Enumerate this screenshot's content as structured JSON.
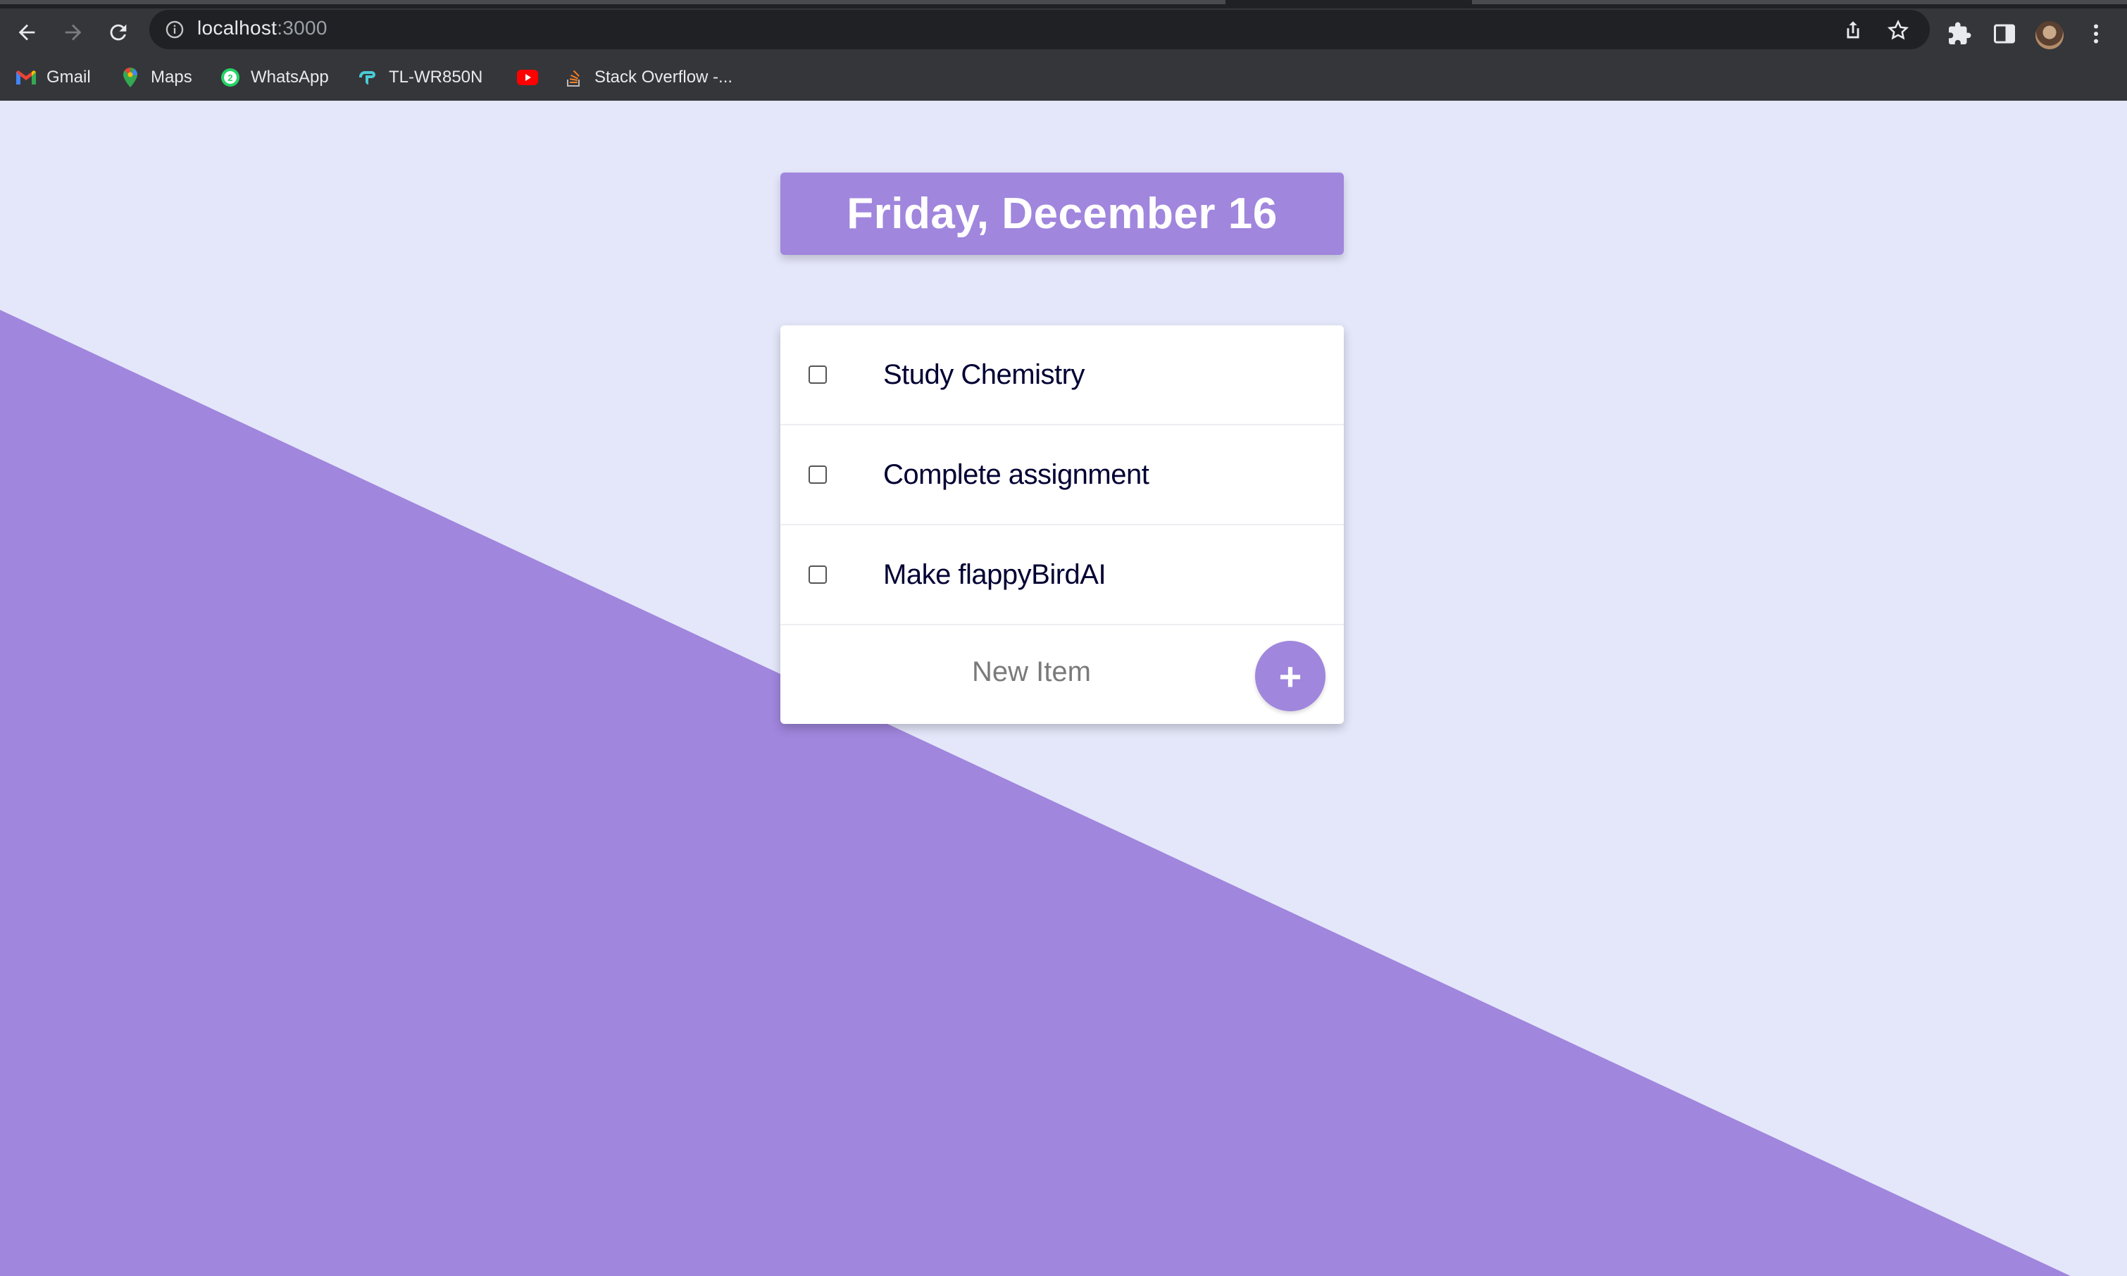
{
  "browser": {
    "url_host": "localhost",
    "url_port": ":3000",
    "icons": {
      "back": "back-arrow-icon",
      "forward": "forward-arrow-icon",
      "reload": "reload-icon",
      "info": "info-icon",
      "share": "share-icon",
      "star": "star-icon",
      "extensions": "puzzle-icon",
      "side_panel": "side-panel-icon",
      "menu": "kebab-menu-icon"
    },
    "bookmarks": [
      {
        "label": "Gmail",
        "icon": "gmail-icon"
      },
      {
        "label": "Maps",
        "icon": "maps-icon"
      },
      {
        "label": "WhatsApp",
        "icon": "whatsapp-icon"
      },
      {
        "label": "TL-WR850N",
        "icon": "tplink-icon"
      },
      {
        "label": "",
        "icon": "youtube-icon"
      },
      {
        "label": "Stack Overflow -...",
        "icon": "stackoverflow-icon"
      }
    ]
  },
  "app": {
    "heading": "Friday, December 16",
    "items": [
      {
        "text": "Study Chemistry",
        "checked": false
      },
      {
        "text": "Complete assignment",
        "checked": false
      },
      {
        "text": "Make flappyBirdAI",
        "checked": false
      }
    ],
    "new_item_placeholder": "New Item",
    "add_button_label": "+"
  },
  "colors": {
    "accent": "#A086DD",
    "background": "#E4E7FA",
    "item_text": "#000033"
  }
}
